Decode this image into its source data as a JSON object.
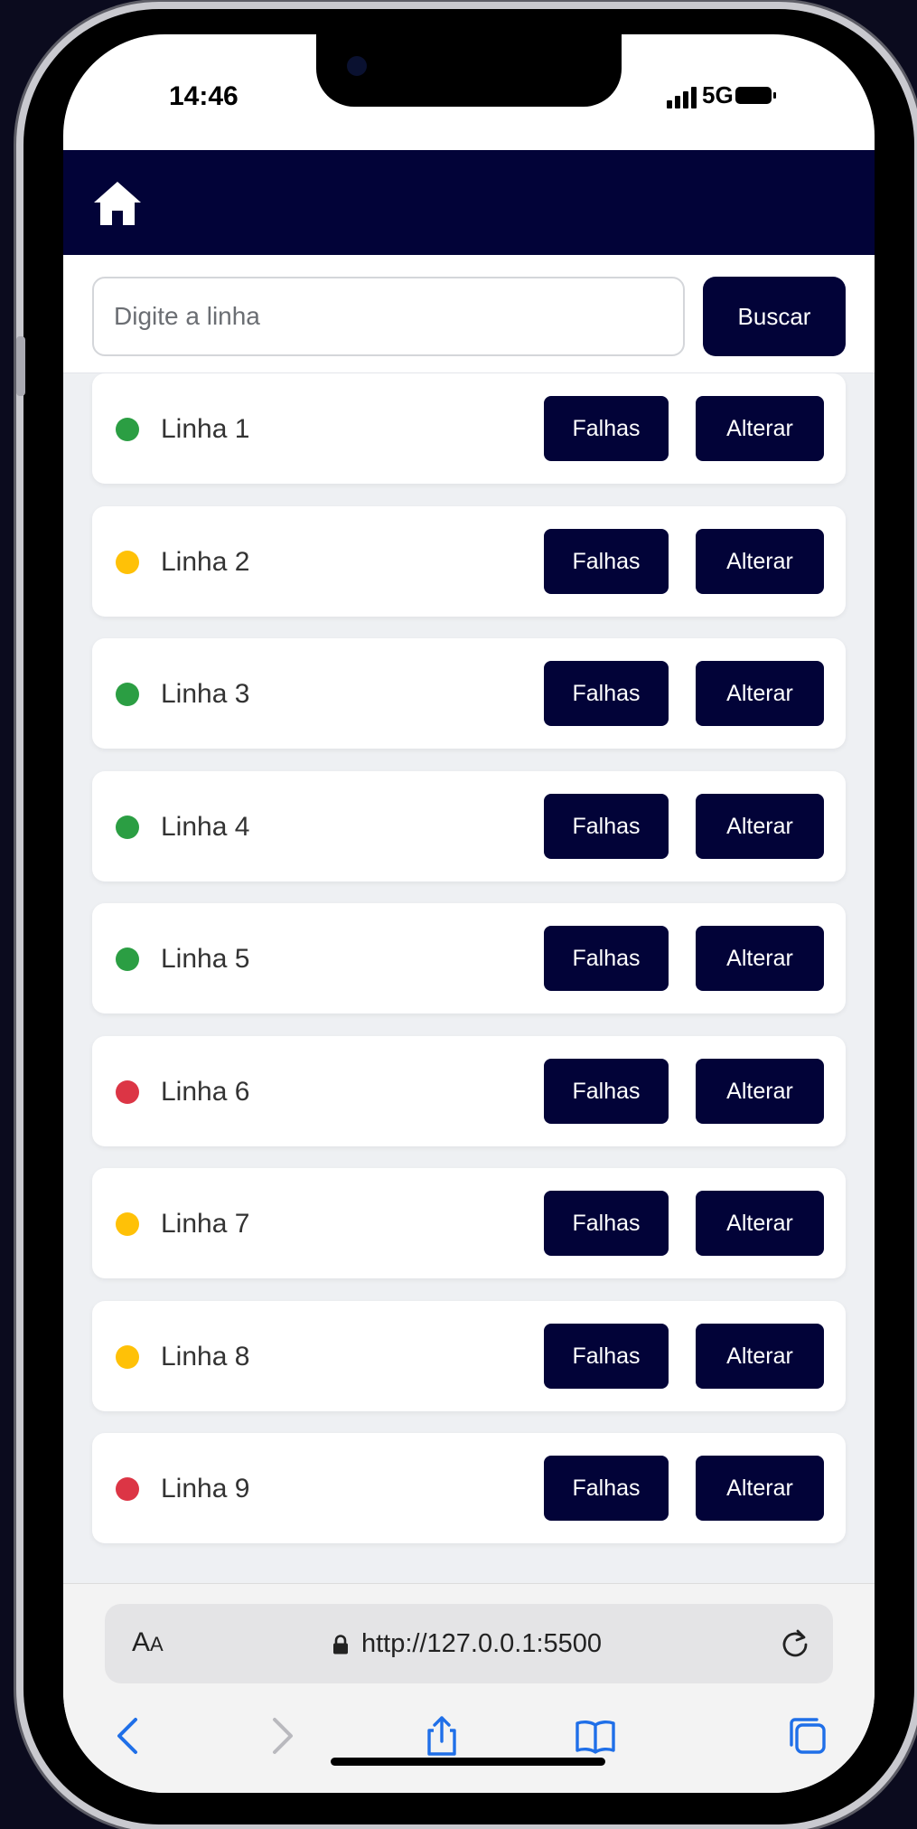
{
  "status_bar": {
    "time": "14:46",
    "network": "5G"
  },
  "header": {
    "home_icon": "home-icon"
  },
  "search": {
    "placeholder": "Digite a linha",
    "value": "",
    "button_label": "Buscar"
  },
  "status_colors": {
    "green": "#2b9e43",
    "yellow": "#ffc107",
    "red": "#dc3545"
  },
  "theme": {
    "navy": "#020338"
  },
  "lines": [
    {
      "label": "Linha 1",
      "status": "green",
      "falhas_label": "Falhas",
      "alterar_label": "Alterar"
    },
    {
      "label": "Linha 2",
      "status": "yellow",
      "falhas_label": "Falhas",
      "alterar_label": "Alterar"
    },
    {
      "label": "Linha 3",
      "status": "green",
      "falhas_label": "Falhas",
      "alterar_label": "Alterar"
    },
    {
      "label": "Linha 4",
      "status": "green",
      "falhas_label": "Falhas",
      "alterar_label": "Alterar"
    },
    {
      "label": "Linha 5",
      "status": "green",
      "falhas_label": "Falhas",
      "alterar_label": "Alterar"
    },
    {
      "label": "Linha 6",
      "status": "red",
      "falhas_label": "Falhas",
      "alterar_label": "Alterar"
    },
    {
      "label": "Linha 7",
      "status": "yellow",
      "falhas_label": "Falhas",
      "alterar_label": "Alterar"
    },
    {
      "label": "Linha 8",
      "status": "yellow",
      "falhas_label": "Falhas",
      "alterar_label": "Alterar"
    },
    {
      "label": "Linha 9",
      "status": "red",
      "falhas_label": "Falhas",
      "alterar_label": "Alterar"
    }
  ],
  "browser": {
    "text_size_big": "A",
    "text_size_small": "A",
    "url": "http://127.0.0.1:5500"
  }
}
